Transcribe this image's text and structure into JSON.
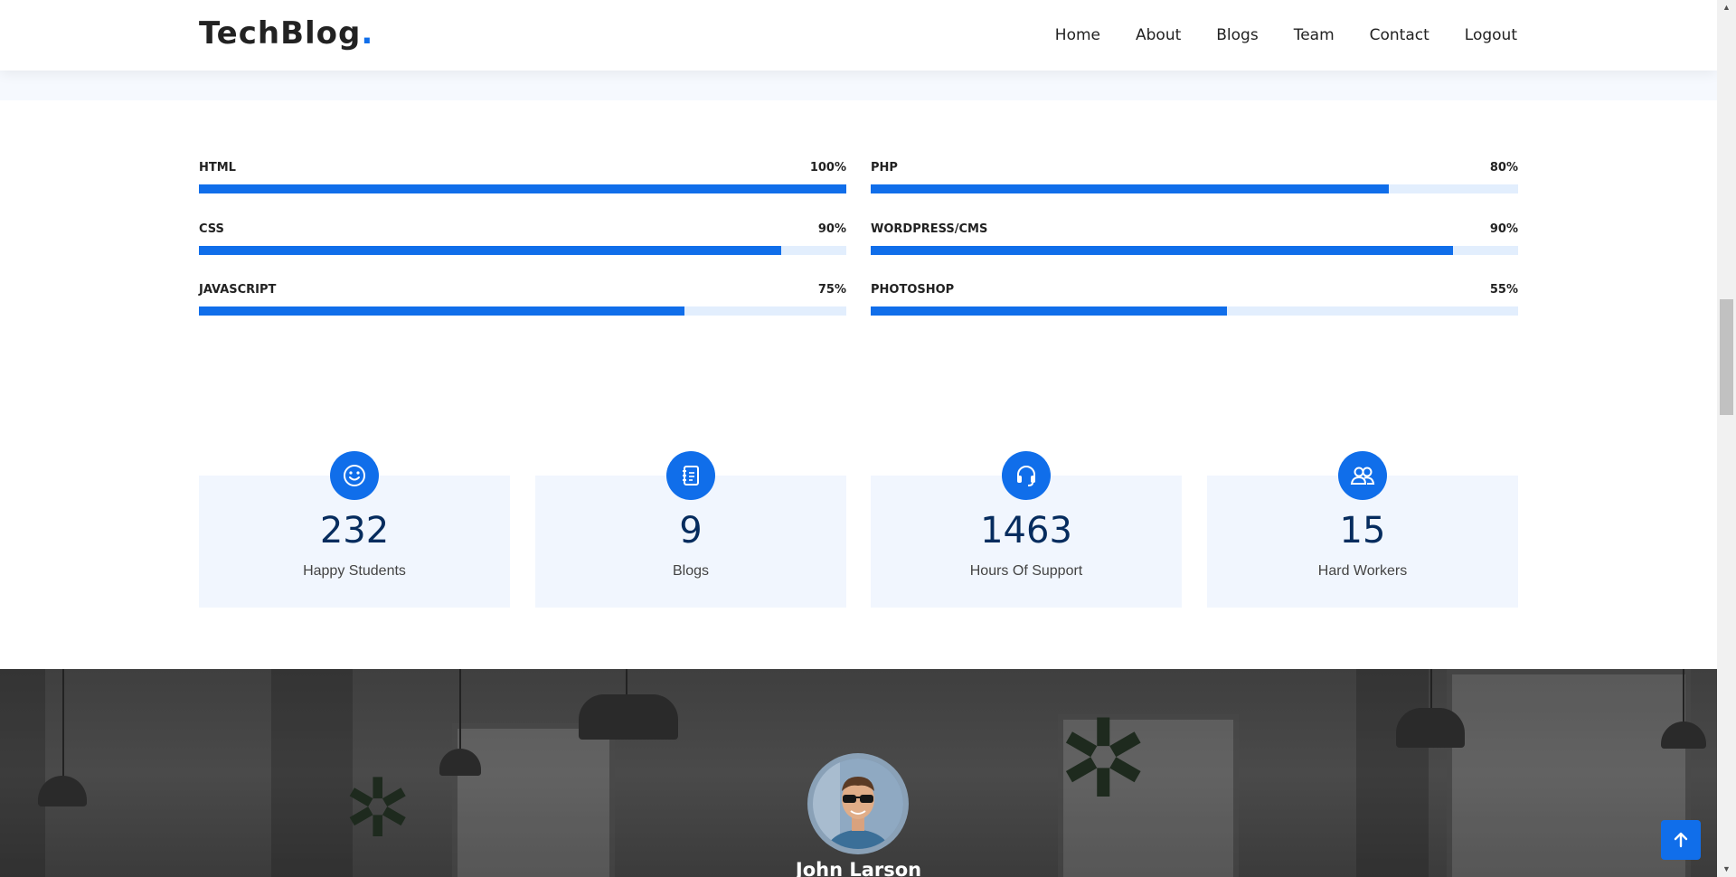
{
  "header": {
    "logo_text": "TechBlog",
    "logo_dot": ".",
    "nav": [
      "Home",
      "About",
      "Blogs",
      "Team",
      "Contact",
      "Logout"
    ]
  },
  "skills": [
    {
      "name": "HTML",
      "value_label": "100%",
      "percent": 100
    },
    {
      "name": "PHP",
      "value_label": "80%",
      "percent": 80
    },
    {
      "name": "CSS",
      "value_label": "90%",
      "percent": 90
    },
    {
      "name": "WORDPRESS/CMS",
      "value_label": "90%",
      "percent": 90
    },
    {
      "name": "JAVASCRIPT",
      "value_label": "75%",
      "percent": 75
    },
    {
      "name": "PHOTOSHOP",
      "value_label": "55%",
      "percent": 55
    }
  ],
  "counters": [
    {
      "number": "232",
      "label": "Happy Students",
      "icon": "smiley-icon"
    },
    {
      "number": "9",
      "label": "Blogs",
      "icon": "journal-icon"
    },
    {
      "number": "1463",
      "label": "Hours Of Support",
      "icon": "headset-icon"
    },
    {
      "number": "15",
      "label": "Hard Workers",
      "icon": "people-icon"
    }
  ],
  "testimonial": {
    "name": "John Larson"
  },
  "colors": {
    "accent": "#106eea",
    "track": "#e2eefd",
    "counter_bg": "#f1f6fe",
    "counter_number": "#062c5e"
  },
  "back_to_top_icon": "arrow-up-icon"
}
